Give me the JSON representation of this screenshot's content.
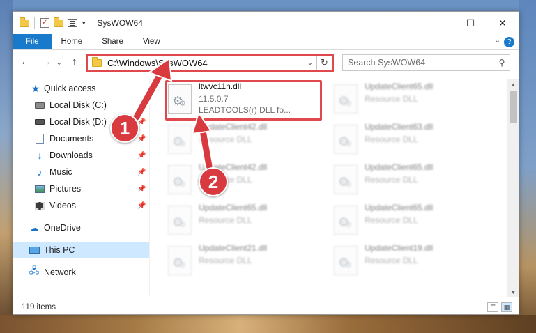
{
  "window": {
    "title": "SysWOW64",
    "controls": {
      "minimize": "—",
      "maximize": "☐",
      "close": "✕"
    }
  },
  "ribbon": {
    "tabs": [
      "File",
      "Home",
      "Share",
      "View"
    ],
    "expand_icon": "chevron-down-icon",
    "help": "?"
  },
  "address_bar": {
    "path": "C:\\Windows\\SysWOW64",
    "refresh_icon": "↻"
  },
  "search": {
    "placeholder": "Search SysWOW64"
  },
  "nav_pane": {
    "items": [
      {
        "label": "Quick access",
        "icon": "star-icon",
        "pinned": false
      },
      {
        "label": "Local Disk (C:)",
        "icon": "disk-icon",
        "pinned": true
      },
      {
        "label": "Local Disk (D:)",
        "icon": "disk-icon",
        "pinned": true
      },
      {
        "label": "Documents",
        "icon": "documents-icon",
        "pinned": true
      },
      {
        "label": "Downloads",
        "icon": "downloads-icon",
        "pinned": true
      },
      {
        "label": "Music",
        "icon": "music-icon",
        "pinned": true
      },
      {
        "label": "Pictures",
        "icon": "pictures-icon",
        "pinned": true
      },
      {
        "label": "Videos",
        "icon": "videos-icon",
        "pinned": true
      },
      {
        "label": "OneDrive",
        "icon": "onedrive-icon",
        "pinned": false
      },
      {
        "label": "This PC",
        "icon": "pc-icon",
        "pinned": false,
        "selected": true
      },
      {
        "label": "Network",
        "icon": "network-icon",
        "pinned": false
      }
    ]
  },
  "files": {
    "highlighted": {
      "name": "ltwvc11n.dll",
      "version": "11.5.0.7",
      "description": "LEADTOOLS(r) DLL fo..."
    },
    "blurred": [
      {
        "name": "UpdateClient65.dll",
        "type": "Resource DLL"
      },
      {
        "name": "UpdateClient42.dll",
        "type": "Resource DLL"
      },
      {
        "name": "UpdateClient63.dll",
        "type": "Resource DLL"
      },
      {
        "name": "UpdateClient42.dll",
        "type": "Resource DLL"
      },
      {
        "name": "UpdateClient65.dll",
        "type": "Resource DLL"
      },
      {
        "name": "UpdateClient65.dll",
        "type": "Resource DLL"
      },
      {
        "name": "UpdateClient65.dll",
        "type": "Resource DLL"
      },
      {
        "name": "UpdateClient21.dll",
        "type": "Resource DLL"
      },
      {
        "name": "UpdateClient19.dll",
        "type": "Resource DLL"
      }
    ]
  },
  "status_bar": {
    "item_count": "119 items"
  },
  "callouts": {
    "one": "1",
    "two": "2"
  },
  "colors": {
    "accent": "#1979ca",
    "highlight_red": "#e0484d",
    "selection": "#cde8ff"
  }
}
